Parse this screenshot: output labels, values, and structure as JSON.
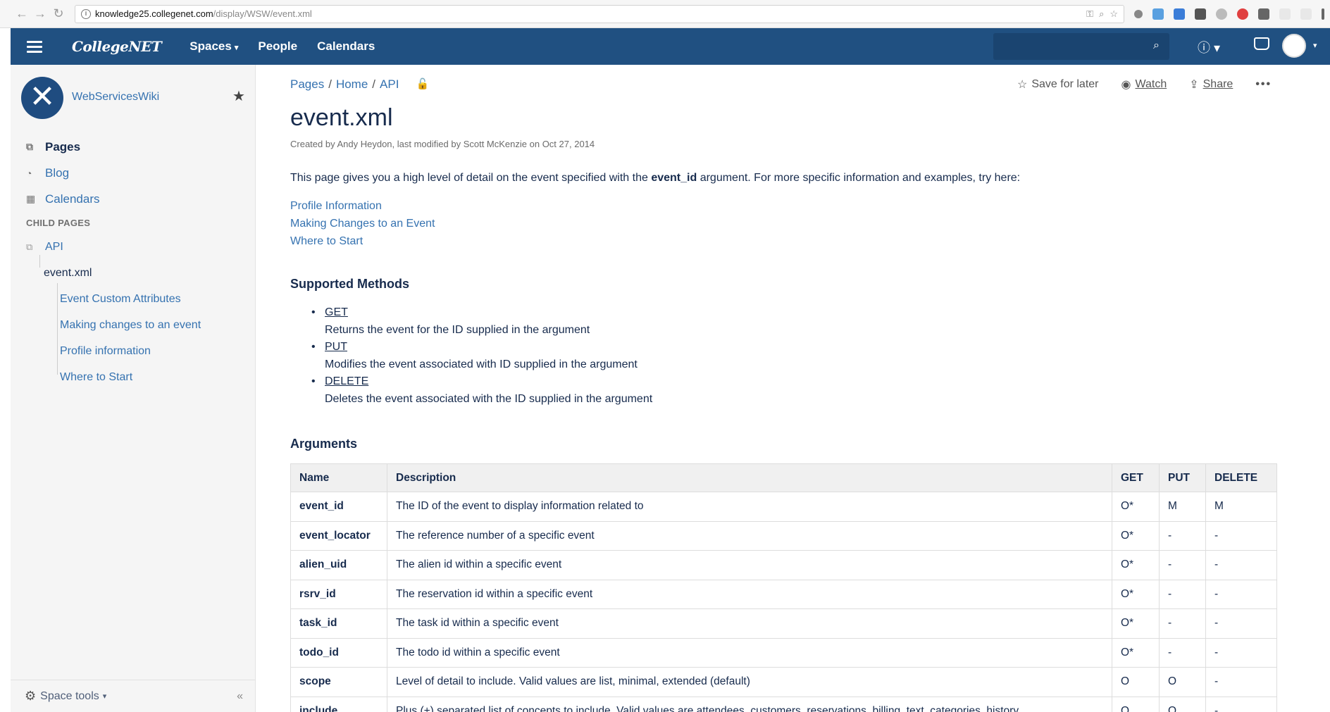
{
  "browser": {
    "url_domain": "knowledge25.collegenet.com",
    "url_path": "/display/WSW/event.xml"
  },
  "header": {
    "logo": "CollegeNET",
    "menu": [
      {
        "label": "Spaces",
        "caret": "▾"
      },
      {
        "label": "People"
      },
      {
        "label": "Calendars"
      }
    ]
  },
  "sidebar": {
    "space_name": "WebServicesWiki",
    "links": [
      {
        "label": "Pages",
        "icon": "pages-icon"
      },
      {
        "label": "Blog",
        "icon": "blog-icon"
      },
      {
        "label": "Calendars",
        "icon": "calendar-icon"
      }
    ],
    "child_pages_heading": "CHILD PAGES",
    "tree": [
      {
        "label": "API"
      },
      {
        "label": "event.xml"
      },
      {
        "label": "Event Custom Attributes"
      },
      {
        "label": "Making changes to an event"
      },
      {
        "label": "Profile information"
      },
      {
        "label": "Where to Start"
      }
    ],
    "space_tools": "Space tools"
  },
  "page": {
    "breadcrumb": [
      "Pages",
      "Home",
      "API"
    ],
    "actions": {
      "save_for_later": "Save for later",
      "watch": "Watch",
      "share": "Share",
      "more": "•••"
    },
    "title": "event.xml",
    "meta": "Created by Andy Heydon, last modified by Scott McKenzie on Oct 27, 2014",
    "intro_before": "This page gives you a high level of detail on the event specified with the ",
    "intro_bold": "event_id",
    "intro_after": " argument. For more specific information and examples, try here:",
    "links": [
      "Profile Information",
      "Making Changes to an Event",
      "Where to Start"
    ],
    "supported_methods_heading": "Supported Methods",
    "methods": [
      {
        "name": "GET",
        "desc": "Returns the event for the ID supplied in the argument"
      },
      {
        "name": "PUT",
        "desc": "Modifies the event associated with ID supplied in the argument"
      },
      {
        "name": "DELETE",
        "desc": "Deletes the event associated with the ID supplied in the argument"
      }
    ],
    "arguments_heading": "Arguments",
    "table": {
      "headers": [
        "Name",
        "Description",
        "GET",
        "PUT",
        "DELETE"
      ],
      "rows": [
        [
          "event_id",
          "The ID of the event to display information related to",
          "O*",
          "M",
          "M"
        ],
        [
          "event_locator",
          "The reference number of a specific event",
          "O*",
          "-",
          "-"
        ],
        [
          "alien_uid",
          "The alien id within a specific event",
          "O*",
          "-",
          "-"
        ],
        [
          "rsrv_id",
          "The reservation id within a specific event",
          "O*",
          "-",
          "-"
        ],
        [
          "task_id",
          "The task id within a specific event",
          "O*",
          "-",
          "-"
        ],
        [
          "todo_id",
          "The todo id within a specific event",
          "O*",
          "-",
          "-"
        ],
        [
          "scope",
          "Level of detail to include. Valid values are list, minimal, extended (default)",
          "O",
          "O",
          "-"
        ],
        [
          "include",
          "Plus (+) separated list of concepts to include. Valid values are attendees, customers, reservations, billing, text, categories, history",
          "O",
          "O",
          "-"
        ]
      ]
    }
  },
  "colors": {
    "header_bg": "#205081",
    "link": "#3572b0",
    "sidebar_bg": "#f5f5f5"
  }
}
